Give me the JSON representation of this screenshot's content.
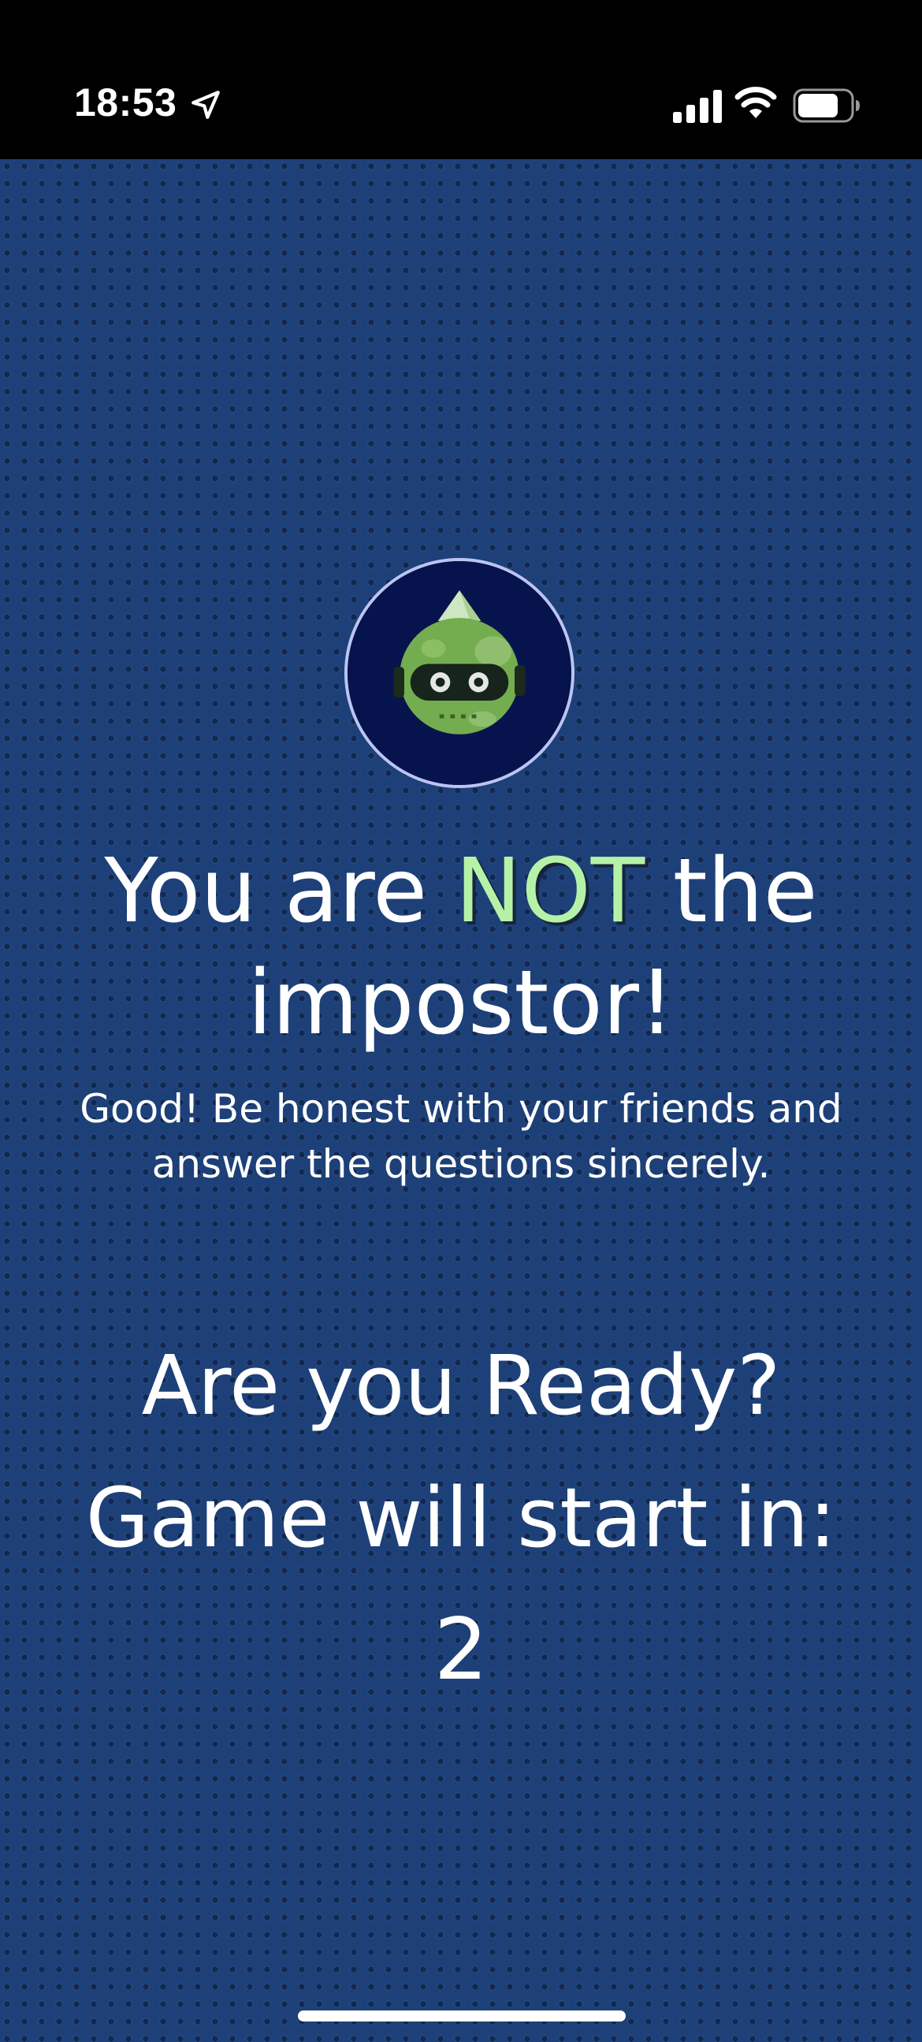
{
  "status_bar": {
    "time": "18:53",
    "icons": [
      "location-arrow-icon",
      "cellular-signal-icon",
      "wifi-icon",
      "battery-icon"
    ]
  },
  "avatar": {
    "icon": "green-robot-avatar-icon"
  },
  "result": {
    "headline_before": "You are",
    "headline_highlight": "NOT",
    "headline_after": "the impostor!",
    "subtitle": "Good! Be honest with your friends and answer the questions sincerely."
  },
  "countdown": {
    "ready_text": "Are you Ready?",
    "start_text": "Game will start in:",
    "value": "2"
  },
  "colors": {
    "background": "#1d4078",
    "highlight": "#b5f2a8",
    "status_bar": "#000000",
    "avatar_background": "#06134d",
    "avatar_ring": "#bcc4f2"
  }
}
